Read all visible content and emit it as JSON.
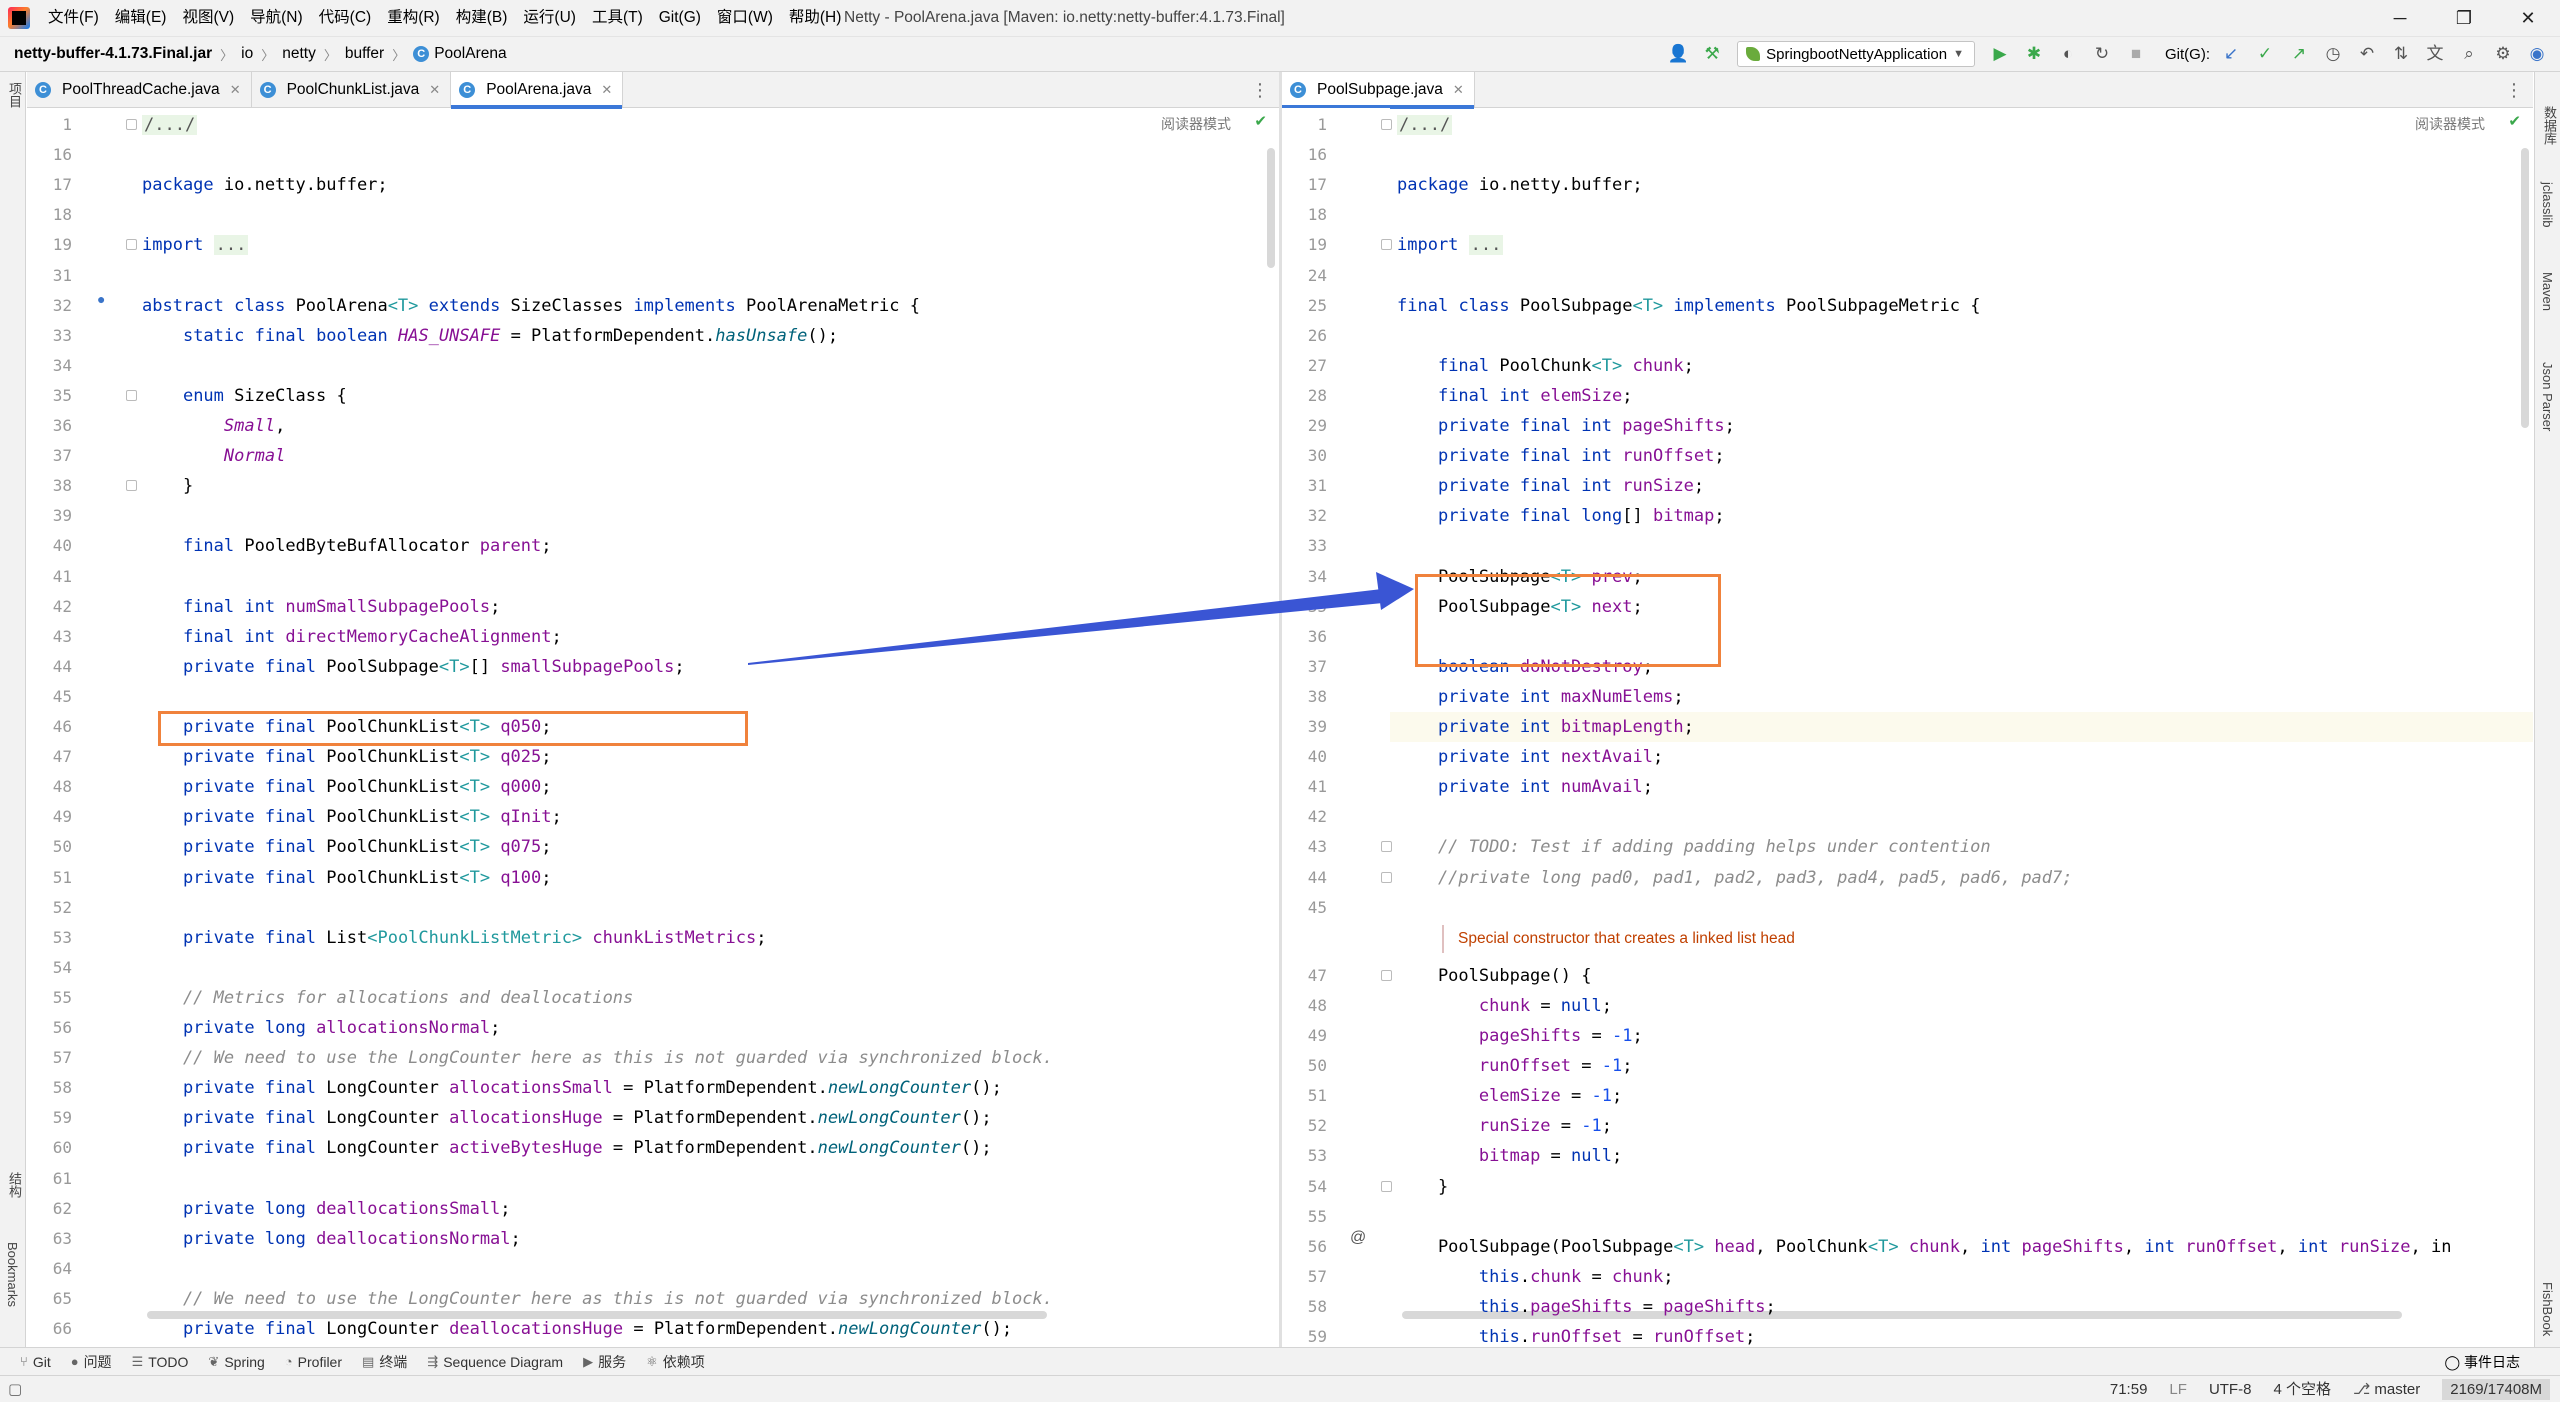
{
  "app": {
    "window_title": "Netty - PoolArena.java [Maven: io.netty:netty-buffer:4.1.73.Final]"
  },
  "menu": [
    "文件(F)",
    "编辑(E)",
    "视图(V)",
    "导航(N)",
    "代码(C)",
    "重构(R)",
    "构建(B)",
    "运行(U)",
    "工具(T)",
    "Git(G)",
    "窗口(W)",
    "帮助(H)"
  ],
  "breadcrumb": [
    "netty-buffer-4.1.73.Final.jar",
    "io",
    "netty",
    "buffer",
    "PoolArena"
  ],
  "toolbar": {
    "run_config": "SpringbootNettyApplication",
    "git_label": "Git(G):"
  },
  "left_strip": {
    "project": "项目",
    "structure": "结构",
    "bookmarks": "Bookmarks"
  },
  "right_strip": {
    "database": "数据库",
    "jclasslib": "jclasslib",
    "maven": "Maven",
    "json": "Json Parser",
    "fishbook": "FishBook"
  },
  "left_editor": {
    "tabs": [
      {
        "label": "PoolThreadCache.java",
        "active": false
      },
      {
        "label": "PoolChunkList.java",
        "active": false
      },
      {
        "label": "PoolArena.java",
        "active": true
      }
    ],
    "reader_mode": "阅读器模式",
    "lines": [
      {
        "n": "1",
        "t": "/.../"
      },
      {
        "n": "16",
        "t": ""
      },
      {
        "n": "17",
        "t": "package io.netty.buffer;"
      },
      {
        "n": "18",
        "t": ""
      },
      {
        "n": "19",
        "t": "import ..."
      },
      {
        "n": "31",
        "t": ""
      },
      {
        "n": "32",
        "t": "abstract class PoolArena<T> extends SizeClasses implements PoolArenaMetric {"
      },
      {
        "n": "33",
        "t": "    static final boolean HAS_UNSAFE = PlatformDependent.hasUnsafe();"
      },
      {
        "n": "34",
        "t": ""
      },
      {
        "n": "35",
        "t": "    enum SizeClass {"
      },
      {
        "n": "36",
        "t": "        Small,"
      },
      {
        "n": "37",
        "t": "        Normal"
      },
      {
        "n": "38",
        "t": "    }"
      },
      {
        "n": "39",
        "t": ""
      },
      {
        "n": "40",
        "t": "    final PooledByteBufAllocator parent;"
      },
      {
        "n": "41",
        "t": ""
      },
      {
        "n": "42",
        "t": "    final int numSmallSubpagePools;"
      },
      {
        "n": "43",
        "t": "    final int directMemoryCacheAlignment;"
      },
      {
        "n": "44",
        "t": "    private final PoolSubpage<T>[] smallSubpagePools;"
      },
      {
        "n": "45",
        "t": ""
      },
      {
        "n": "46",
        "t": "    private final PoolChunkList<T> q050;"
      },
      {
        "n": "47",
        "t": "    private final PoolChunkList<T> q025;"
      },
      {
        "n": "48",
        "t": "    private final PoolChunkList<T> q000;"
      },
      {
        "n": "49",
        "t": "    private final PoolChunkList<T> qInit;"
      },
      {
        "n": "50",
        "t": "    private final PoolChunkList<T> q075;"
      },
      {
        "n": "51",
        "t": "    private final PoolChunkList<T> q100;"
      },
      {
        "n": "52",
        "t": ""
      },
      {
        "n": "53",
        "t": "    private final List<PoolChunkListMetric> chunkListMetrics;"
      },
      {
        "n": "54",
        "t": ""
      },
      {
        "n": "55",
        "t": "    // Metrics for allocations and deallocations"
      },
      {
        "n": "56",
        "t": "    private long allocationsNormal;"
      },
      {
        "n": "57",
        "t": "    // We need to use the LongCounter here as this is not guarded via synchronized block."
      },
      {
        "n": "58",
        "t": "    private final LongCounter allocationsSmall = PlatformDependent.newLongCounter();"
      },
      {
        "n": "59",
        "t": "    private final LongCounter allocationsHuge = PlatformDependent.newLongCounter();"
      },
      {
        "n": "60",
        "t": "    private final LongCounter activeBytesHuge = PlatformDependent.newLongCounter();"
      },
      {
        "n": "61",
        "t": ""
      },
      {
        "n": "62",
        "t": "    private long deallocationsSmall;"
      },
      {
        "n": "63",
        "t": "    private long deallocationsNormal;"
      },
      {
        "n": "64",
        "t": ""
      },
      {
        "n": "65",
        "t": "    // We need to use the LongCounter here as this is not guarded via synchronized block."
      },
      {
        "n": "66",
        "t": "    private final LongCounter deallocationsHuge = PlatformDependent.newLongCounter();"
      }
    ]
  },
  "right_editor": {
    "tabs": [
      {
        "label": "PoolSubpage.java",
        "active": true
      }
    ],
    "reader_mode": "阅读器模式",
    "doc_comment": "Special constructor that creates a linked list head",
    "lines": [
      {
        "n": "1",
        "t": "/.../"
      },
      {
        "n": "16",
        "t": ""
      },
      {
        "n": "17",
        "t": "package io.netty.buffer;"
      },
      {
        "n": "18",
        "t": ""
      },
      {
        "n": "19",
        "t": "import ..."
      },
      {
        "n": "24",
        "t": ""
      },
      {
        "n": "25",
        "t": "final class PoolSubpage<T> implements PoolSubpageMetric {"
      },
      {
        "n": "26",
        "t": ""
      },
      {
        "n": "27",
        "t": "    final PoolChunk<T> chunk;"
      },
      {
        "n": "28",
        "t": "    final int elemSize;"
      },
      {
        "n": "29",
        "t": "    private final int pageShifts;"
      },
      {
        "n": "30",
        "t": "    private final int runOffset;"
      },
      {
        "n": "31",
        "t": "    private final int runSize;"
      },
      {
        "n": "32",
        "t": "    private final long[] bitmap;"
      },
      {
        "n": "33",
        "t": ""
      },
      {
        "n": "34",
        "t": "    PoolSubpage<T> prev;"
      },
      {
        "n": "35",
        "t": "    PoolSubpage<T> next;"
      },
      {
        "n": "36",
        "t": ""
      },
      {
        "n": "37",
        "t": "    boolean doNotDestroy;"
      },
      {
        "n": "38",
        "t": "    private int maxNumElems;"
      },
      {
        "n": "39",
        "t": "    private int bitmapLength;"
      },
      {
        "n": "40",
        "t": "    private int nextAvail;"
      },
      {
        "n": "41",
        "t": "    private int numAvail;"
      },
      {
        "n": "42",
        "t": ""
      },
      {
        "n": "43",
        "t": "    // TODO: Test if adding padding helps under contention"
      },
      {
        "n": "44",
        "t": "    //private long pad0, pad1, pad2, pad3, pad4, pad5, pad6, pad7;"
      },
      {
        "n": "45",
        "t": ""
      },
      {
        "n": "",
        "t": ""
      },
      {
        "n": "47",
        "t": "    PoolSubpage() {"
      },
      {
        "n": "48",
        "t": "        chunk = null;"
      },
      {
        "n": "49",
        "t": "        pageShifts = -1;"
      },
      {
        "n": "50",
        "t": "        runOffset = -1;"
      },
      {
        "n": "51",
        "t": "        elemSize = -1;"
      },
      {
        "n": "52",
        "t": "        runSize = -1;"
      },
      {
        "n": "53",
        "t": "        bitmap = null;"
      },
      {
        "n": "54",
        "t": "    }"
      },
      {
        "n": "55",
        "t": ""
      },
      {
        "n": "56",
        "t": "    PoolSubpage(PoolSubpage<T> head, PoolChunk<T> chunk, int pageShifts, int runOffset, int runSize, in"
      },
      {
        "n": "57",
        "t": "        this.chunk = chunk;"
      },
      {
        "n": "58",
        "t": "        this.pageShifts = pageShifts;"
      },
      {
        "n": "59",
        "t": "        this.runOffset = runOffset;"
      }
    ]
  },
  "tool_windows": [
    {
      "label": "Git",
      "icon": "git-icon"
    },
    {
      "label": "问题",
      "icon": "problems-icon"
    },
    {
      "label": "TODO",
      "icon": "todo-icon"
    },
    {
      "label": "Spring",
      "icon": "spring-icon"
    },
    {
      "label": "Profiler",
      "icon": "profiler-icon"
    },
    {
      "label": "终端",
      "icon": "terminal-icon"
    },
    {
      "label": "Sequence Diagram",
      "icon": "sequence-icon"
    },
    {
      "label": "服务",
      "icon": "services-icon"
    },
    {
      "label": "依赖项",
      "icon": "dependencies-icon"
    }
  ],
  "event_log": "事件日志",
  "status": {
    "position": "71:59",
    "line_sep": "LF",
    "encoding": "UTF-8",
    "indent": "4 个空格",
    "branch": "master",
    "memory": "2169/17408M"
  },
  "annotation": {
    "color": "#f0823c",
    "arrow_color": "#3a55d4"
  }
}
